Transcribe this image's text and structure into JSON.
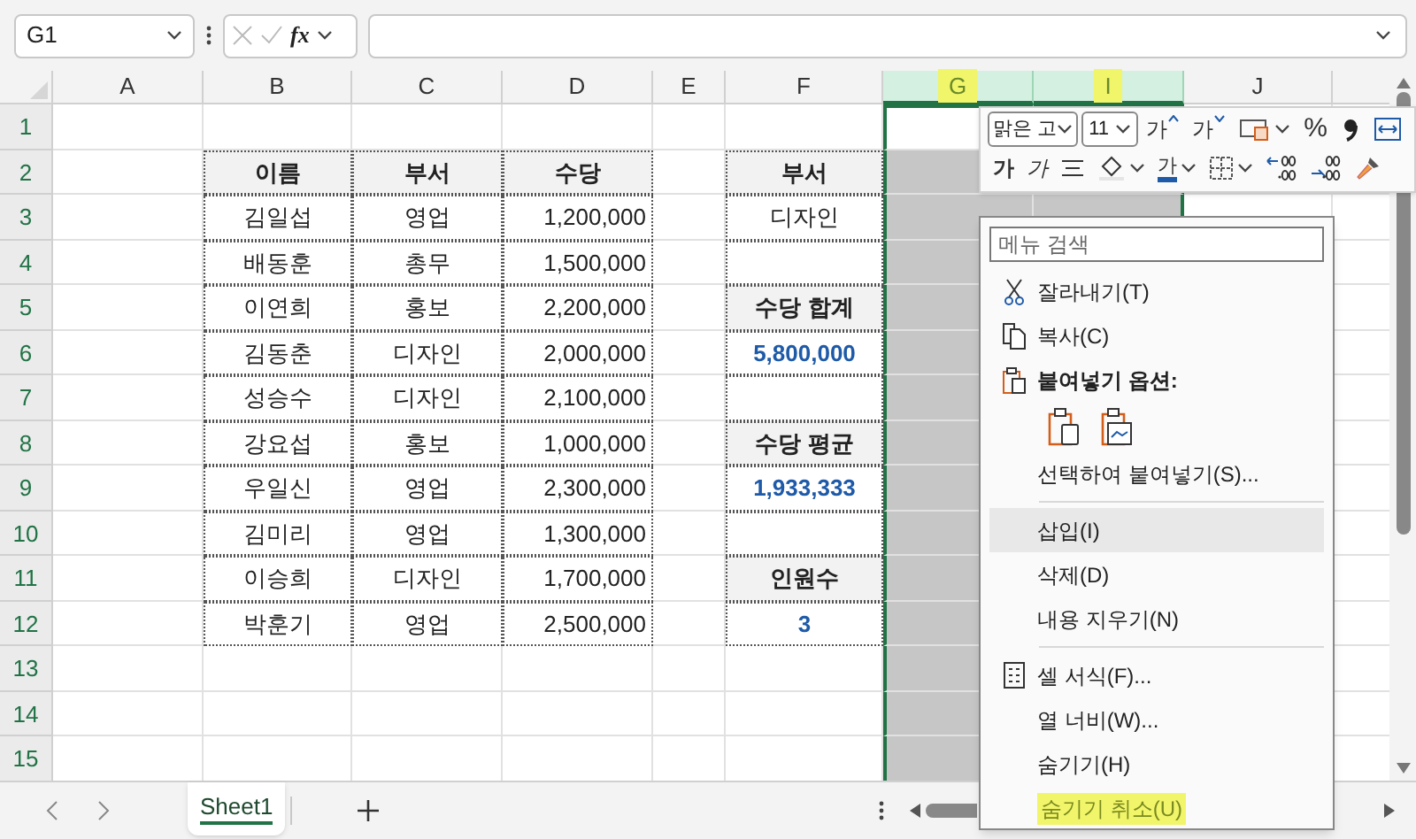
{
  "name_box": {
    "value": "G1"
  },
  "formula_bar": {
    "fx": "fx"
  },
  "columns": [
    {
      "label": "A",
      "selected": false,
      "highlighted": false
    },
    {
      "label": "B",
      "selected": false,
      "highlighted": false
    },
    {
      "label": "C",
      "selected": false,
      "highlighted": false
    },
    {
      "label": "D",
      "selected": false,
      "highlighted": false
    },
    {
      "label": "E",
      "selected": false,
      "highlighted": false
    },
    {
      "label": "F",
      "selected": false,
      "highlighted": false
    },
    {
      "label": "G",
      "selected": true,
      "highlighted": true
    },
    {
      "label": "I",
      "selected": true,
      "highlighted": true
    },
    {
      "label": "J",
      "selected": false,
      "highlighted": false
    }
  ],
  "rows": [
    {
      "number": "1"
    },
    {
      "number": "2",
      "cells": {
        "B": {
          "kind": "header",
          "text": "이름"
        },
        "C": {
          "kind": "header",
          "text": "부서"
        },
        "D": {
          "kind": "header",
          "text": "수당"
        },
        "F": {
          "kind": "header",
          "text": "부서"
        }
      }
    },
    {
      "number": "3",
      "cells": {
        "B": {
          "kind": "text",
          "text": "김일섭"
        },
        "C": {
          "kind": "text",
          "text": "영업"
        },
        "D": {
          "kind": "number",
          "text": "1,200,000"
        },
        "F": {
          "kind": "text",
          "text": "디자인"
        }
      }
    },
    {
      "number": "4",
      "cells": {
        "B": {
          "kind": "text",
          "text": "배동훈"
        },
        "C": {
          "kind": "text",
          "text": "총무"
        },
        "D": {
          "kind": "number",
          "text": "1,500,000"
        },
        "F": {
          "kind": "blank"
        }
      }
    },
    {
      "number": "5",
      "cells": {
        "B": {
          "kind": "text",
          "text": "이연희"
        },
        "C": {
          "kind": "text",
          "text": "홍보"
        },
        "D": {
          "kind": "number",
          "text": "2,200,000"
        },
        "F": {
          "kind": "header",
          "text": "수당 합계"
        }
      }
    },
    {
      "number": "6",
      "cells": {
        "B": {
          "kind": "text",
          "text": "김동춘"
        },
        "C": {
          "kind": "text",
          "text": "디자인"
        },
        "D": {
          "kind": "number",
          "text": "2,000,000"
        },
        "F": {
          "kind": "result",
          "text": "5,800,000"
        }
      }
    },
    {
      "number": "7",
      "cells": {
        "B": {
          "kind": "text",
          "text": "성승수"
        },
        "C": {
          "kind": "text",
          "text": "디자인"
        },
        "D": {
          "kind": "number",
          "text": "2,100,000"
        },
        "F": {
          "kind": "blank"
        }
      }
    },
    {
      "number": "8",
      "cells": {
        "B": {
          "kind": "text",
          "text": "강요섭"
        },
        "C": {
          "kind": "text",
          "text": "홍보"
        },
        "D": {
          "kind": "number",
          "text": "1,000,000"
        },
        "F": {
          "kind": "header",
          "text": "수당 평균"
        }
      }
    },
    {
      "number": "9",
      "cells": {
        "B": {
          "kind": "text",
          "text": "우일신"
        },
        "C": {
          "kind": "text",
          "text": "영업"
        },
        "D": {
          "kind": "number",
          "text": "2,300,000"
        },
        "F": {
          "kind": "result",
          "text": "1,933,333"
        }
      }
    },
    {
      "number": "10",
      "cells": {
        "B": {
          "kind": "text",
          "text": "김미리"
        },
        "C": {
          "kind": "text",
          "text": "영업"
        },
        "D": {
          "kind": "number",
          "text": "1,300,000"
        },
        "F": {
          "kind": "blank"
        }
      }
    },
    {
      "number": "11",
      "cells": {
        "B": {
          "kind": "text",
          "text": "이승희"
        },
        "C": {
          "kind": "text",
          "text": "디자인"
        },
        "D": {
          "kind": "number",
          "text": "1,700,000"
        },
        "F": {
          "kind": "header",
          "text": "인원수"
        }
      }
    },
    {
      "number": "12",
      "cells": {
        "B": {
          "kind": "text",
          "text": "박훈기"
        },
        "C": {
          "kind": "text",
          "text": "영업"
        },
        "D": {
          "kind": "number",
          "text": "2,500,000"
        },
        "F": {
          "kind": "result",
          "text": "3"
        }
      }
    },
    {
      "number": "13"
    },
    {
      "number": "14"
    },
    {
      "number": "15"
    }
  ],
  "mini_toolbar": {
    "font_name": "맑은 고",
    "font_size": "11",
    "row_1": [
      {
        "kind": "grow_font",
        "label": "가"
      },
      {
        "kind": "shrink_font",
        "label": "가"
      },
      {
        "kind": "cell_style"
      },
      {
        "kind": "percent",
        "label": "%"
      },
      {
        "kind": "comma"
      },
      {
        "kind": "merge"
      }
    ],
    "row_2": [
      {
        "kind": "bold",
        "label": "가"
      },
      {
        "kind": "italic",
        "label": "가"
      },
      {
        "kind": "align"
      },
      {
        "kind": "fill"
      },
      {
        "kind": "font_color",
        "label": "가"
      },
      {
        "kind": "borders"
      },
      {
        "kind": "increase_decimal"
      },
      {
        "kind": "decrease_decimal"
      },
      {
        "kind": "format_painter"
      }
    ]
  },
  "context_menu": {
    "search_placeholder": "메뉴 검색",
    "items": [
      {
        "kind": "cut",
        "label": "잘라내기(T)",
        "hovered": false,
        "highlighted": false
      },
      {
        "kind": "copy",
        "label": "복사(C)",
        "hovered": false,
        "highlighted": false
      },
      {
        "kind": "heading",
        "label": "붙여넣기 옵션:"
      },
      {
        "kind": "paste_options"
      },
      {
        "kind": "command",
        "label": "선택하여 붙여넣기(S)...",
        "hovered": false,
        "highlighted": false
      },
      {
        "kind": "separator"
      },
      {
        "kind": "command",
        "label": "삽입(I)",
        "hovered": true,
        "highlighted": false
      },
      {
        "kind": "command",
        "label": "삭제(D)",
        "hovered": false,
        "highlighted": false
      },
      {
        "kind": "command",
        "label": "내용 지우기(N)",
        "hovered": false,
        "highlighted": false
      },
      {
        "kind": "separator"
      },
      {
        "kind": "format",
        "label": "셀 서식(F)...",
        "hovered": false,
        "highlighted": false
      },
      {
        "kind": "command",
        "label": "열 너비(W)...",
        "hovered": false,
        "highlighted": false
      },
      {
        "kind": "command",
        "label": "숨기기(H)",
        "hovered": false,
        "highlighted": false
      },
      {
        "kind": "command",
        "label": "숨기기 취소(U)",
        "hovered": false,
        "highlighted": true
      }
    ]
  },
  "sheets": [
    {
      "label": "Sheet1",
      "selected": true
    }
  ]
}
